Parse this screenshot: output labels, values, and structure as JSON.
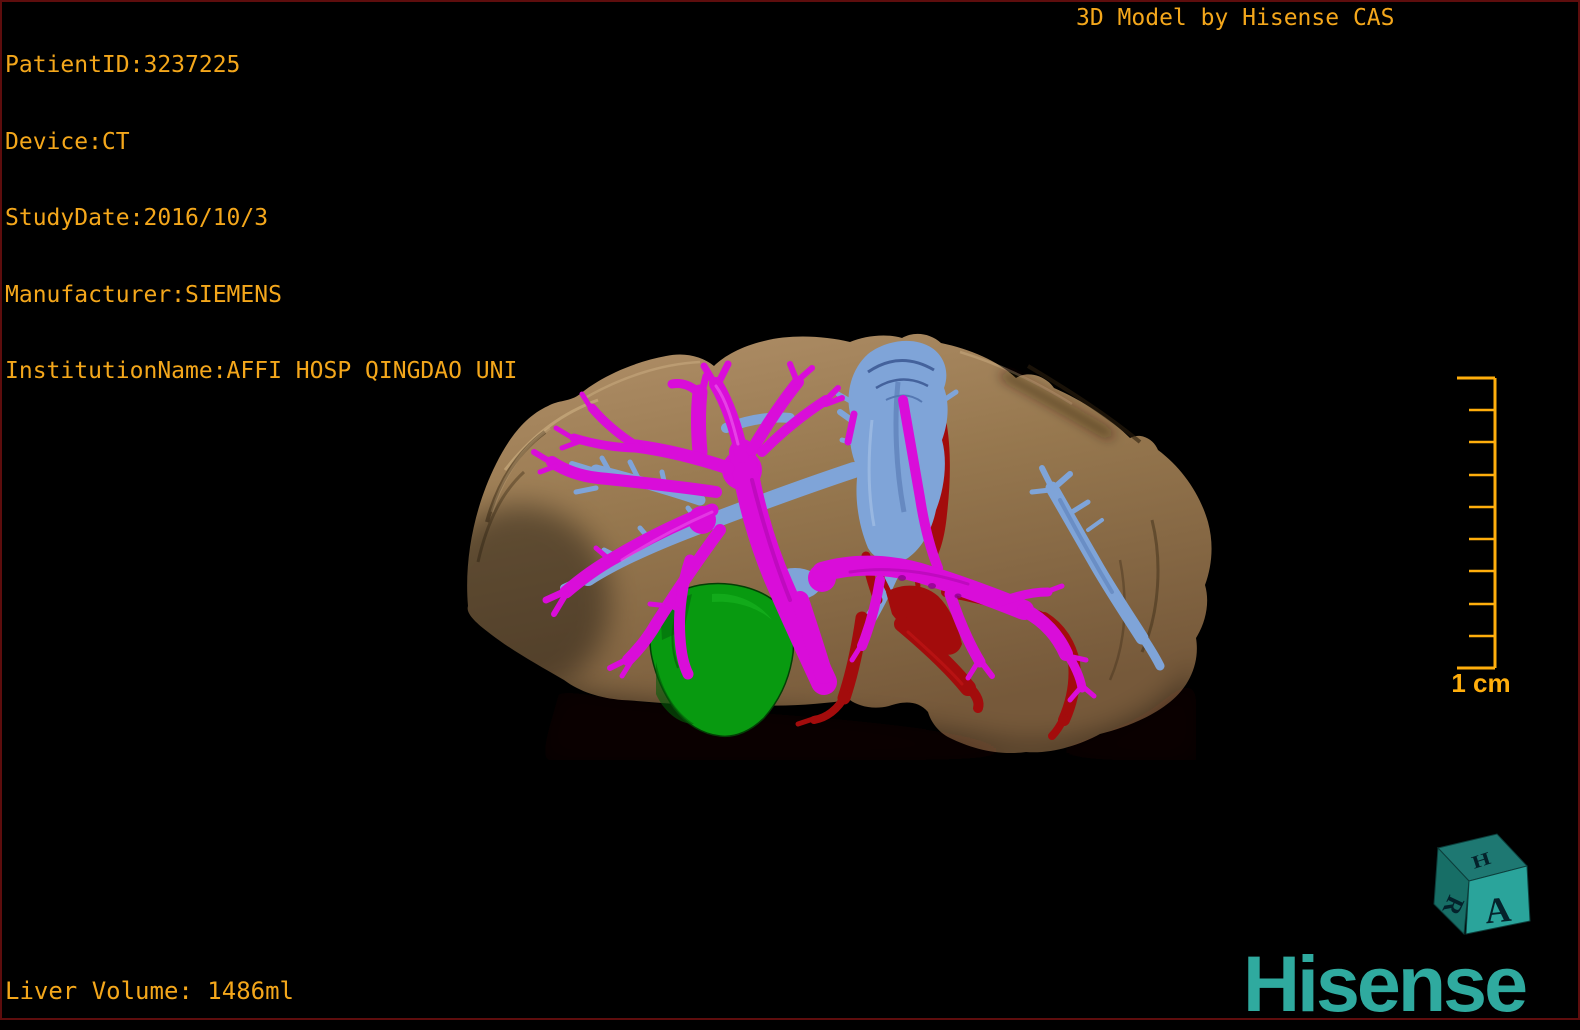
{
  "app": {
    "title_right": "3D Model by Hisense CAS"
  },
  "patient_info": {
    "lines": [
      "PatientID:3237225",
      "Device:CT",
      "StudyDate:2016/10/3",
      "Manufacturer:SIEMENS",
      "InstitutionName:AFFI HOSP QINGDAO UNI"
    ]
  },
  "measurements": {
    "liver_volume": "Liver Volume: 1486ml"
  },
  "scale_bar": {
    "label": "1 cm",
    "tick_count": 10
  },
  "orientation_cube": {
    "front": "A",
    "left": "R",
    "top": "H"
  },
  "branding": {
    "logo": "Hisense"
  },
  "model": {
    "structures": [
      {
        "name": "liver",
        "color": "#9A7B52"
      },
      {
        "name": "portal-vein",
        "color": "#D90DD9"
      },
      {
        "name": "hepatic-vein",
        "color": "#7FA4D8"
      },
      {
        "name": "hepatic-artery",
        "color": "#A30C0C"
      },
      {
        "name": "tumor",
        "color": "#089A10"
      }
    ]
  },
  "colors": {
    "overlay_text": "#F4A71B",
    "scale_bar": "#FFAE0C",
    "border": "#5E0D0D",
    "background": "#000000",
    "liver": "#9A7B52",
    "portal_vein": "#D90DD9",
    "hepatic_vein": "#7FA4D8",
    "artery": "#A30C0C",
    "tumor": "#089A10",
    "logo_teal": "#2FAA9F",
    "cube_front": "#2AA49B",
    "cube_top": "#1E7872",
    "cube_left": "#176E66"
  }
}
